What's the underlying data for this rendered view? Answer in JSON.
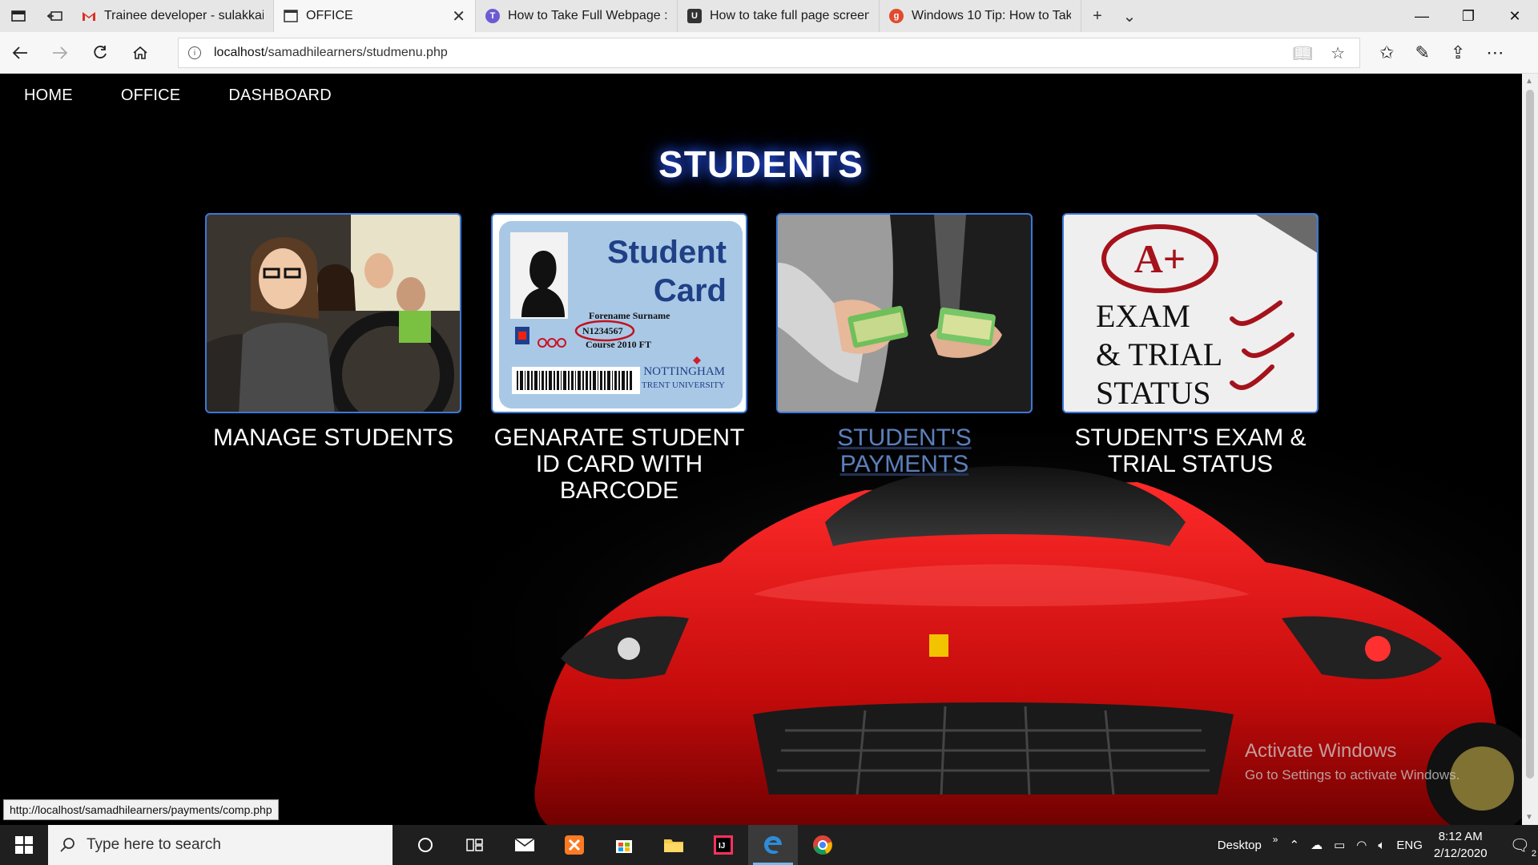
{
  "browser": {
    "tabs": [
      {
        "title": "Trainee developer - sulakkai",
        "icon": "gmail-icon",
        "active": false
      },
      {
        "title": "OFFICE",
        "icon": "page-icon",
        "active": true
      },
      {
        "title": "How to Take Full Webpage :",
        "icon": "site-icon",
        "active": false
      },
      {
        "title": "How to take full page screen",
        "icon": "site-icon",
        "active": false
      },
      {
        "title": "Windows 10 Tip: How to Tak",
        "icon": "site-icon",
        "active": false
      }
    ],
    "url_host": "localhost",
    "url_path": "/samadhilearners/studmenu.php"
  },
  "nav": {
    "home": "HOME",
    "office": "OFFICE",
    "dashboard": "DASHBOARD"
  },
  "page": {
    "heading": "STUDENTS",
    "cards": [
      {
        "caption": "MANAGE STUDENTS"
      },
      {
        "caption": "GENARATE STUDENT ID CARD WITH BARCODE",
        "idcard": {
          "title1": "Student",
          "title2": "Card",
          "name": "Forename Surname",
          "number": "N1234567",
          "course": "Course 2010 FT",
          "uni1": "NOTTINGHAM",
          "uni2": "TRENT UNIVERSITY"
        }
      },
      {
        "caption": "STUDENT'S PAYMENTS"
      },
      {
        "caption": "STUDENT'S EXAM & TRIAL STATUS",
        "exam": {
          "grade": "A+",
          "line1": "EXAM",
          "line2": "& TRIAL",
          "line3": "STATUS"
        }
      }
    ]
  },
  "watermark": {
    "line1": "Activate Windows",
    "line2": "Go to Settings to activate Windows."
  },
  "status_url": "http://localhost/samadhilearners/payments/comp.php",
  "taskbar": {
    "search_placeholder": "Type here to search",
    "desktop_label": "Desktop",
    "lang": "ENG",
    "time": "8:12 AM",
    "date": "2/12/2020",
    "notification_count": "2"
  }
}
